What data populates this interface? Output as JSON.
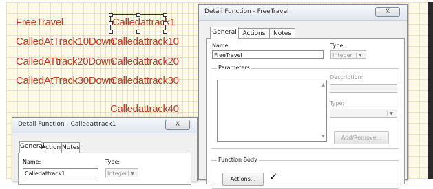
{
  "canvas": {
    "labels": [
      "FreeTravel",
      "Calledattrack1",
      "CalledAtTrack10Down",
      "Calledattrack10",
      "CalledATtrack20Down",
      "Calledattrack20",
      "CalledAtTrack30Down",
      "Calledattrack30",
      "Calledattrack40"
    ]
  },
  "dialog_front": {
    "title": "Detail Function - FreeTravel",
    "close_glyph": "X",
    "tabs": [
      "General",
      "Actions",
      "Notes"
    ],
    "name_label": "Name:",
    "name_value": "FreeTravel",
    "type_label": "Type:",
    "type_value": "Integer",
    "parameters_label": "Parameters",
    "description_label": "Description:",
    "param_type_label": "Type:",
    "add_remove_label": "Add/Remove...",
    "function_body_label": "Function Body",
    "actions_button_label": "Actions...",
    "check_glyph": "✓"
  },
  "dialog_back": {
    "title": "Detail Function - Calledattrack1",
    "close_glyph": "X",
    "tabs": [
      "General",
      "Actions",
      "Notes"
    ],
    "name_label": "Name:",
    "name_value": "Calledattrack1",
    "type_label": "Type:",
    "type_value": "Integer"
  }
}
